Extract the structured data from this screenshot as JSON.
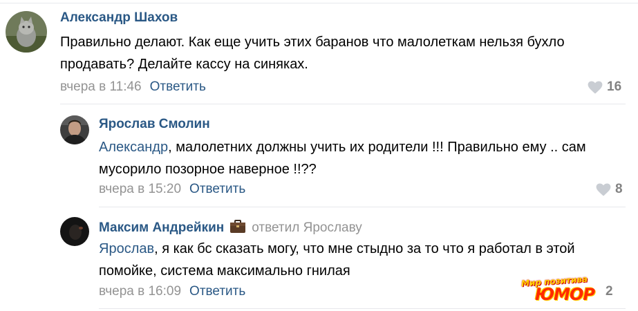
{
  "comments": [
    {
      "author": "Александр Шахов",
      "reply_to": "",
      "text_plain": "Правильно делают. Как еще учить этих баранов что малолеткам нельзя бухло продавать? Делайте кассу на синяках.",
      "date": "вчера в 11:46",
      "reply_label": "Ответить",
      "likes": "16",
      "avatar_icon": "cat-photo-avatar"
    },
    {
      "author": "Ярослав Смолин",
      "reply_to": "",
      "mention": "Александр",
      "text_plain": ", малолетних должны учить их родители !!! Правильно ему .. сам мусорило позорное наверное !!??",
      "date": "вчера в 15:20",
      "reply_label": "Ответить",
      "likes": "8",
      "avatar_icon": "man-photo-avatar"
    },
    {
      "author": "Максим Андрейкин",
      "reply_to": "ответил Ярославу",
      "mention": "Ярослав",
      "text_plain": ", я как бс сказать могу, что мне стыдно за то что я работал в этой помойке, система максимально гнилая",
      "date": "вчера в 16:09",
      "reply_label": "Ответить",
      "likes": "2",
      "avatar_icon": "dark-photo-avatar",
      "badge_icon": "briefcase-icon"
    }
  ],
  "watermark": {
    "line1": "Мир позитива",
    "line2": "ЮМОР"
  },
  "colors": {
    "link": "#2a5885",
    "meta": "#939393",
    "likes": "#828282",
    "divider": "#e7e8ec"
  }
}
